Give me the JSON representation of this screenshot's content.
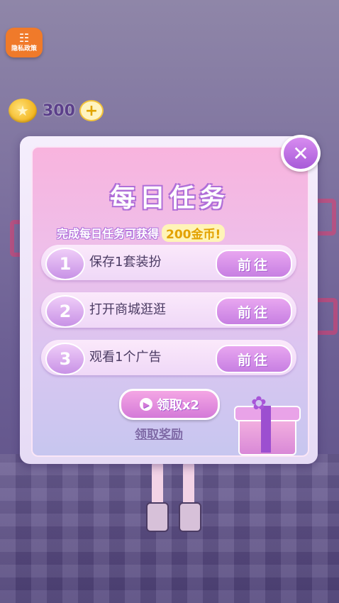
{
  "privacy": {
    "icon": "☷",
    "label": "隐私政策"
  },
  "coins": {
    "icon": "★",
    "amount": "300",
    "plus": "+"
  },
  "dialog": {
    "close": "✕",
    "title": "每日任务",
    "subtitle_prefix": "完成每日任务可获得",
    "subtitle_highlight": "200金币!",
    "tasks": [
      {
        "num": "1",
        "label": "保存1套装扮",
        "button": "前往"
      },
      {
        "num": "2",
        "label": "打开商城逛逛",
        "button": "前往"
      },
      {
        "num": "3",
        "label": "观看1个广告",
        "button": "前往"
      }
    ],
    "claim_double": {
      "icon": "▶",
      "label": "领取x2"
    },
    "claim": "领取奖励"
  }
}
